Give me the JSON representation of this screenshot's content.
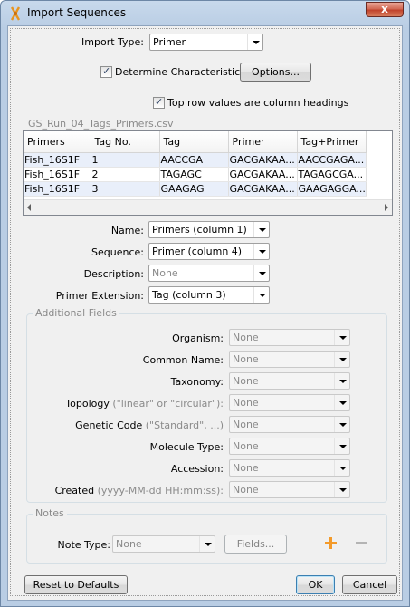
{
  "window": {
    "title": "Import Sequences",
    "close_glyph": "x"
  },
  "import_type": {
    "label": "Import Type:",
    "value": "Primer"
  },
  "determine_characteristics": {
    "label": "Determine Characteristics",
    "checked": true
  },
  "options_button": "Options...",
  "top_row_headings": {
    "label": "Top row values are column headings",
    "checked": true
  },
  "file_name": "GS_Run_04_Tags_Primers.csv",
  "table": {
    "columns": [
      "Primers",
      "Tag No.",
      "Tag",
      "Primer",
      "Tag+Primer"
    ],
    "rows": [
      [
        "Fish_16S1F",
        "1",
        "AACCGA",
        "GACGAKAA...",
        "AACCGAGA..."
      ],
      [
        "Fish_16S1F",
        "2",
        "TAGAGC",
        "GACGAKAA...",
        "TAGAGCGA..."
      ],
      [
        "Fish_16S1F",
        "3",
        "GAAGAG",
        "GACGAKAA...",
        "GAAGAGGA..."
      ]
    ]
  },
  "mapping": {
    "name": {
      "label": "Name:",
      "value": "Primers (column 1)"
    },
    "sequence": {
      "label": "Sequence:",
      "value": "Primer (column 4)"
    },
    "description": {
      "label": "Description:",
      "value": "None"
    },
    "primer_extension": {
      "label": "Primer Extension:",
      "value": "Tag (column 3)"
    }
  },
  "additional_fields": {
    "title": "Additional Fields",
    "organism": {
      "label": "Organism:",
      "value": "None"
    },
    "common_name": {
      "label": "Common Name:",
      "value": "None"
    },
    "taxonomy": {
      "label": "Taxonomy:",
      "value": "None"
    },
    "topology": {
      "label": "Topology",
      "hint": "(\"linear\" or \"circular\"):",
      "value": "None"
    },
    "genetic_code": {
      "label": "Genetic Code",
      "hint": "(\"Standard\", ...)",
      "value": "None"
    },
    "molecule_type": {
      "label": "Molecule Type:",
      "value": "None"
    },
    "accession": {
      "label": "Accession:",
      "value": "None"
    },
    "created": {
      "label": "Created",
      "hint": "(yyyy-MM-dd HH:mm:ss):",
      "value": "None"
    }
  },
  "notes": {
    "title": "Notes",
    "note_type_label": "Note Type:",
    "note_type_value": "None",
    "fields_button": "Fields..."
  },
  "footer": {
    "reset": "Reset to Defaults",
    "ok": "OK",
    "cancel": "Cancel"
  },
  "colors": {
    "title_bar": "#b9cde4",
    "close_button": "#c0432c",
    "row_highlight": "#e9effa",
    "add_icon": "#f39a2a"
  }
}
